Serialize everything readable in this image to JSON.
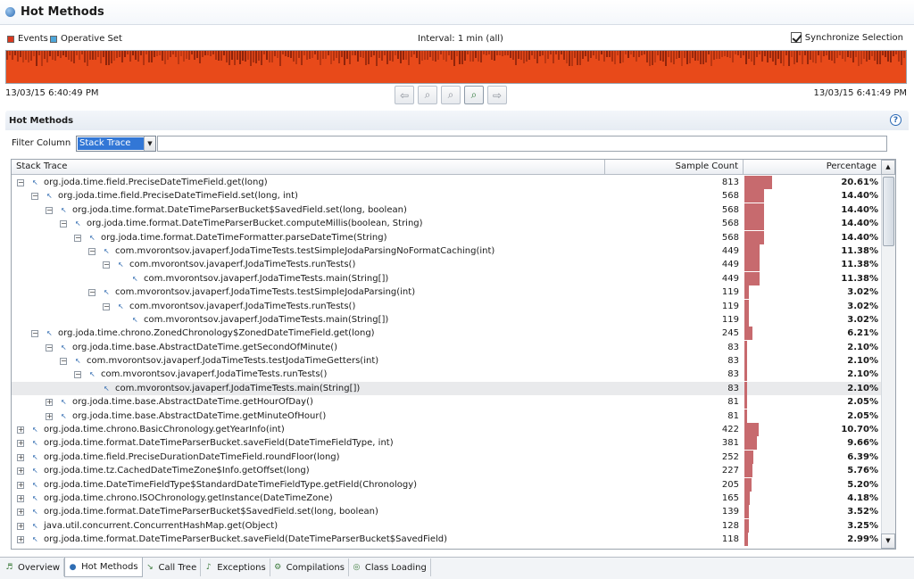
{
  "title": "Hot Methods",
  "legend": {
    "events_label": "Events",
    "events_color": "#d9381e",
    "operative_label": "Operative Set",
    "operative_color": "#4da6d9"
  },
  "interval_label": "Interval: 1 min (all)",
  "synchronize_label": "Synchronize Selection",
  "synchronize_checked": true,
  "time_start": "13/03/15 6:40:49 PM",
  "time_end": "13/03/15 6:41:49 PM",
  "section_title": "Hot Methods",
  "filter": {
    "label": "Filter Column",
    "selected": "Stack Trace",
    "value": ""
  },
  "table": {
    "columns": [
      "Stack Trace",
      "Sample Count",
      "Percentage"
    ],
    "rows": [
      {
        "name": "org.joda.time.field.PreciseDateTimeField.get(long)",
        "count": "813",
        "pct": "20.61%",
        "frac": 0.2061,
        "depth": 0,
        "expander": "-"
      },
      {
        "name": "org.joda.time.field.PreciseDateTimeField.set(long, int)",
        "count": "568",
        "pct": "14.40%",
        "frac": 0.144,
        "depth": 1,
        "expander": "-"
      },
      {
        "name": "org.joda.time.format.DateTimeParserBucket$SavedField.set(long, boolean)",
        "count": "568",
        "pct": "14.40%",
        "frac": 0.144,
        "depth": 2,
        "expander": "-"
      },
      {
        "name": "org.joda.time.format.DateTimeParserBucket.computeMillis(boolean, String)",
        "count": "568",
        "pct": "14.40%",
        "frac": 0.144,
        "depth": 3,
        "expander": "-"
      },
      {
        "name": "org.joda.time.format.DateTimeFormatter.parseDateTime(String)",
        "count": "568",
        "pct": "14.40%",
        "frac": 0.144,
        "depth": 4,
        "expander": "-"
      },
      {
        "name": "com.mvorontsov.javaperf.JodaTimeTests.testSimpleJodaParsingNoFormatCaching(int)",
        "count": "449",
        "pct": "11.38%",
        "frac": 0.1138,
        "depth": 5,
        "expander": "-"
      },
      {
        "name": "com.mvorontsov.javaperf.JodaTimeTests.runTests()",
        "count": "449",
        "pct": "11.38%",
        "frac": 0.1138,
        "depth": 6,
        "expander": "-"
      },
      {
        "name": "com.mvorontsov.javaperf.JodaTimeTests.main(String[])",
        "count": "449",
        "pct": "11.38%",
        "frac": 0.1138,
        "depth": 7,
        "expander": ""
      },
      {
        "name": "com.mvorontsov.javaperf.JodaTimeTests.testSimpleJodaParsing(int)",
        "count": "119",
        "pct": "3.02%",
        "frac": 0.0302,
        "depth": 5,
        "expander": "-"
      },
      {
        "name": "com.mvorontsov.javaperf.JodaTimeTests.runTests()",
        "count": "119",
        "pct": "3.02%",
        "frac": 0.0302,
        "depth": 6,
        "expander": "-"
      },
      {
        "name": "com.mvorontsov.javaperf.JodaTimeTests.main(String[])",
        "count": "119",
        "pct": "3.02%",
        "frac": 0.0302,
        "depth": 7,
        "expander": ""
      },
      {
        "name": "org.joda.time.chrono.ZonedChronology$ZonedDateTimeField.get(long)",
        "count": "245",
        "pct": "6.21%",
        "frac": 0.0621,
        "depth": 1,
        "expander": "-"
      },
      {
        "name": "org.joda.time.base.AbstractDateTime.getSecondOfMinute()",
        "count": "83",
        "pct": "2.10%",
        "frac": 0.021,
        "depth": 2,
        "expander": "-"
      },
      {
        "name": "com.mvorontsov.javaperf.JodaTimeTests.testJodaTimeGetters(int)",
        "count": "83",
        "pct": "2.10%",
        "frac": 0.021,
        "depth": 3,
        "expander": "-"
      },
      {
        "name": "com.mvorontsov.javaperf.JodaTimeTests.runTests()",
        "count": "83",
        "pct": "2.10%",
        "frac": 0.021,
        "depth": 4,
        "expander": "-"
      },
      {
        "name": "com.mvorontsov.javaperf.JodaTimeTests.main(String[])",
        "count": "83",
        "pct": "2.10%",
        "frac": 0.021,
        "depth": 5,
        "expander": "",
        "selected": true
      },
      {
        "name": "org.joda.time.base.AbstractDateTime.getHourOfDay()",
        "count": "81",
        "pct": "2.05%",
        "frac": 0.0205,
        "depth": 2,
        "expander": "+"
      },
      {
        "name": "org.joda.time.base.AbstractDateTime.getMinuteOfHour()",
        "count": "81",
        "pct": "2.05%",
        "frac": 0.0205,
        "depth": 2,
        "expander": "+"
      },
      {
        "name": "org.joda.time.chrono.BasicChronology.getYearInfo(int)",
        "count": "422",
        "pct": "10.70%",
        "frac": 0.107,
        "depth": 0,
        "expander": "+"
      },
      {
        "name": "org.joda.time.format.DateTimeParserBucket.saveField(DateTimeFieldType, int)",
        "count": "381",
        "pct": "9.66%",
        "frac": 0.0966,
        "depth": 0,
        "expander": "+"
      },
      {
        "name": "org.joda.time.field.PreciseDurationDateTimeField.roundFloor(long)",
        "count": "252",
        "pct": "6.39%",
        "frac": 0.0639,
        "depth": 0,
        "expander": "+"
      },
      {
        "name": "org.joda.time.tz.CachedDateTimeZone$Info.getOffset(long)",
        "count": "227",
        "pct": "5.76%",
        "frac": 0.0576,
        "depth": 0,
        "expander": "+"
      },
      {
        "name": "org.joda.time.DateTimeFieldType$StandardDateTimeFieldType.getField(Chronology)",
        "count": "205",
        "pct": "5.20%",
        "frac": 0.052,
        "depth": 0,
        "expander": "+"
      },
      {
        "name": "org.joda.time.chrono.ISOChronology.getInstance(DateTimeZone)",
        "count": "165",
        "pct": "4.18%",
        "frac": 0.0418,
        "depth": 0,
        "expander": "+"
      },
      {
        "name": "org.joda.time.format.DateTimeParserBucket$SavedField.set(long, boolean)",
        "count": "139",
        "pct": "3.52%",
        "frac": 0.0352,
        "depth": 0,
        "expander": "+"
      },
      {
        "name": "java.util.concurrent.ConcurrentHashMap.get(Object)",
        "count": "128",
        "pct": "3.25%",
        "frac": 0.0325,
        "depth": 0,
        "expander": "+"
      },
      {
        "name": "org.joda.time.format.DateTimeParserBucket.saveField(DateTimeParserBucket$SavedField)",
        "count": "118",
        "pct": "2.99%",
        "frac": 0.0299,
        "depth": 0,
        "expander": "+"
      }
    ]
  },
  "tabs": [
    {
      "label": "Overview",
      "icon": "overview-icon",
      "active": false
    },
    {
      "label": "Hot Methods",
      "icon": "hot-methods-icon",
      "active": true
    },
    {
      "label": "Call Tree",
      "icon": "call-tree-icon",
      "active": false
    },
    {
      "label": "Exceptions",
      "icon": "exceptions-icon",
      "active": false
    },
    {
      "label": "Compilations",
      "icon": "compilations-icon",
      "active": false
    },
    {
      "label": "Class Loading",
      "icon": "class-loading-icon",
      "active": false
    }
  ],
  "colors": {
    "timeline_fill": "#e84a1a",
    "timeline_dark": "#7a1c08",
    "percentage_bar": "#c76a6e",
    "selection_fill": "#3277d6"
  }
}
